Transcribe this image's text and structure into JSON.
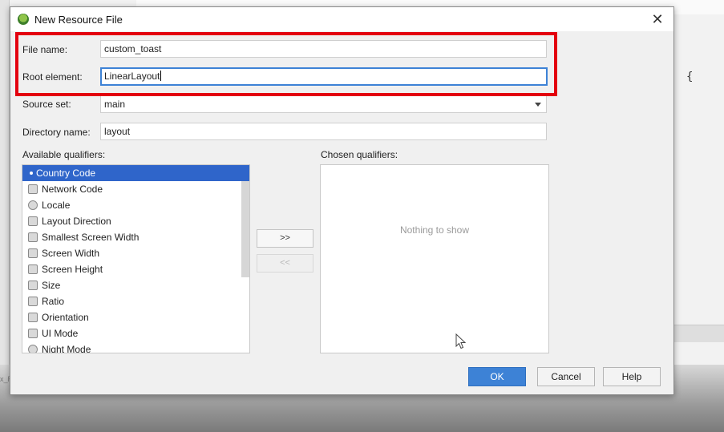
{
  "dialog": {
    "title": "New Resource File",
    "close_glyph": "✕",
    "fields": {
      "file_name": {
        "label": "File name:",
        "value": "custom_toast"
      },
      "root_element": {
        "label": "Root element:",
        "value": "LinearLayout"
      },
      "source_set": {
        "label": "Source set:",
        "value": "main"
      },
      "directory_name": {
        "label": "Directory name:",
        "value": "layout"
      }
    },
    "available_qualifiers": {
      "label": "Available qualifiers:",
      "items": [
        {
          "label": "Country Code",
          "icon": "dot"
        },
        {
          "label": "Network Code",
          "icon": "network-code-icon"
        },
        {
          "label": "Locale",
          "icon": "globe-icon"
        },
        {
          "label": "Layout Direction",
          "icon": "layout-direction-icon"
        },
        {
          "label": "Smallest Screen Width",
          "icon": "smallest-width-icon"
        },
        {
          "label": "Screen Width",
          "icon": "screen-width-icon"
        },
        {
          "label": "Screen Height",
          "icon": "screen-height-icon"
        },
        {
          "label": "Size",
          "icon": "size-icon"
        },
        {
          "label": "Ratio",
          "icon": "ratio-icon"
        },
        {
          "label": "Orientation",
          "icon": "orientation-icon"
        },
        {
          "label": "UI Mode",
          "icon": "ui-mode-icon"
        },
        {
          "label": "Night Mode",
          "icon": "night-mode-icon"
        }
      ],
      "selected_index": 0
    },
    "add_button": ">>",
    "remove_button": "<<",
    "chosen_qualifiers": {
      "label": "Chosen qualifiers:",
      "empty_text": "Nothing to show"
    },
    "buttons": {
      "ok": "OK",
      "cancel": "Cancel",
      "help": "Help"
    }
  },
  "background": {
    "brace": "{",
    "fragment": "x_R"
  },
  "colors": {
    "accent": "#3d82d6",
    "selection": "#2f65ca",
    "highlight_box": "#e3000f"
  }
}
